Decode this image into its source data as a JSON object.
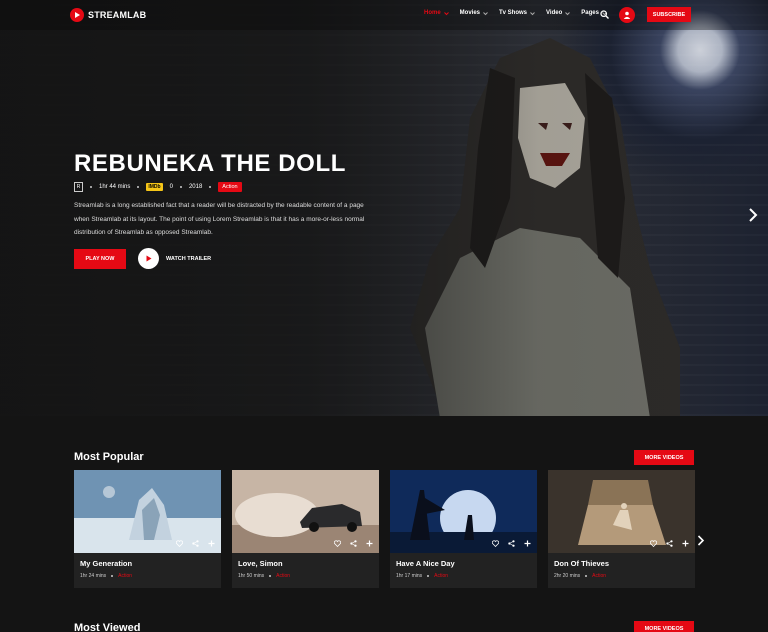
{
  "header": {
    "logo_text": "STREAMLAB",
    "nav": [
      {
        "label": "Home",
        "active": true
      },
      {
        "label": "Movies",
        "active": false
      },
      {
        "label": "Tv Shows",
        "active": false
      },
      {
        "label": "Video",
        "active": false
      },
      {
        "label": "Pages",
        "active": false
      }
    ],
    "subscribe_label": "SUBSCRIBE"
  },
  "hero": {
    "title": "REBUNEKA THE DOLL",
    "rating": "R",
    "duration": "1hr 44 mins",
    "imdb_label": "IMDb",
    "imdb_score": "0",
    "year": "2018",
    "genre": "Action",
    "description": "Streamlab is a long established fact that a reader will be distracted by the readable content of a page when Streamlab at its layout. The point of using Lorem Streamlab is that it has a more-or-less normal distribution of Streamlab as opposed Streamlab.",
    "play_label": "PLAY NOW",
    "trailer_label": "WATCH TRAILER"
  },
  "popular": {
    "title": "Most Popular",
    "more_label": "MORE VIDEOS",
    "cards": [
      {
        "name": "My Generation",
        "duration": "1hr 24 mins",
        "genre": "Action"
      },
      {
        "name": "Love, Simon",
        "duration": "1hr 50 mins",
        "genre": "Action"
      },
      {
        "name": "Have A Nice Day",
        "duration": "1hr 17 mins",
        "genre": "Action"
      },
      {
        "name": "Don Of Thieves",
        "duration": "2hr 20 mins",
        "genre": "Action"
      }
    ]
  },
  "viewed": {
    "title": "Most Viewed",
    "more_label": "MORE VIDEOS"
  },
  "colors": {
    "accent": "#e50914",
    "background": "#141414",
    "card": "#222222",
    "imdb": "#f5c518"
  },
  "icons": [
    "play-icon",
    "chevron-down-icon",
    "search-icon",
    "user-icon",
    "chevron-right-icon",
    "heart-icon",
    "share-icon",
    "plus-icon"
  ]
}
